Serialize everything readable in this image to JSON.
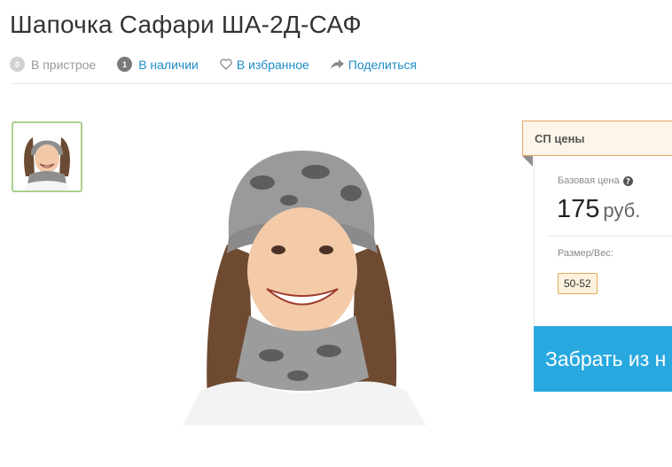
{
  "product": {
    "title": "Шапочка Сафари ША-2Д-САФ"
  },
  "meta": {
    "attached_count": "0",
    "attached_label": "В пристрое",
    "stock_count": "1",
    "stock_label": "В наличии",
    "favorites_label": "В избранное",
    "share_label": "Поделиться"
  },
  "pricing": {
    "panel_title": "СП цены",
    "base_price_label": "Базовая цена",
    "price_value": "175",
    "currency": "руб.",
    "size_label": "Размер/Вес:",
    "size_value": "50-52",
    "cta_label": "Забрать из н"
  },
  "colors": {
    "link": "#1d8dc7",
    "cta": "#29a8e0",
    "accent_orange": "#e9a766",
    "thumb_border": "#a8d08d"
  },
  "icons": [
    "heart-icon",
    "share-icon",
    "question-icon"
  ]
}
